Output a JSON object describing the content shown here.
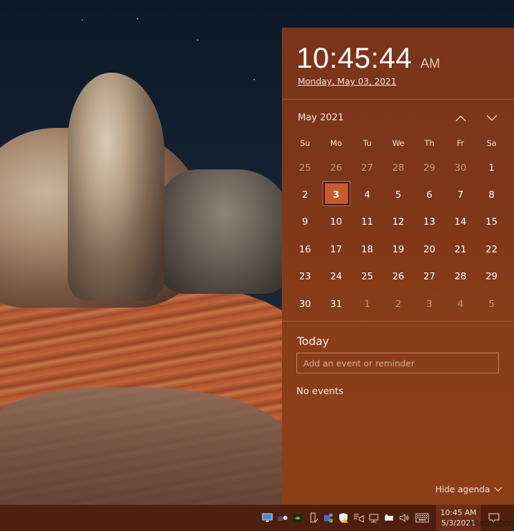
{
  "clock": {
    "time": "10:45:44",
    "ampm": "AM",
    "long_date": "Monday, May 03, 2021"
  },
  "calendar": {
    "month_label": "May 2021",
    "prev_icon": "chevron-up-icon",
    "next_icon": "chevron-down-icon",
    "weekdays": [
      "Su",
      "Mo",
      "Tu",
      "We",
      "Th",
      "Fr",
      "Sa"
    ],
    "selected_day": "3",
    "days": [
      {
        "label": "25",
        "current_month": false
      },
      {
        "label": "26",
        "current_month": false
      },
      {
        "label": "27",
        "current_month": false
      },
      {
        "label": "28",
        "current_month": false
      },
      {
        "label": "29",
        "current_month": false
      },
      {
        "label": "30",
        "current_month": false
      },
      {
        "label": "1",
        "current_month": true
      },
      {
        "label": "2",
        "current_month": true
      },
      {
        "label": "3",
        "current_month": true,
        "today": true
      },
      {
        "label": "4",
        "current_month": true
      },
      {
        "label": "5",
        "current_month": true
      },
      {
        "label": "6",
        "current_month": true
      },
      {
        "label": "7",
        "current_month": true
      },
      {
        "label": "8",
        "current_month": true
      },
      {
        "label": "9",
        "current_month": true
      },
      {
        "label": "10",
        "current_month": true
      },
      {
        "label": "11",
        "current_month": true
      },
      {
        "label": "12",
        "current_month": true
      },
      {
        "label": "13",
        "current_month": true
      },
      {
        "label": "14",
        "current_month": true
      },
      {
        "label": "15",
        "current_month": true
      },
      {
        "label": "16",
        "current_month": true
      },
      {
        "label": "17",
        "current_month": true
      },
      {
        "label": "18",
        "current_month": true
      },
      {
        "label": "19",
        "current_month": true
      },
      {
        "label": "20",
        "current_month": true
      },
      {
        "label": "21",
        "current_month": true
      },
      {
        "label": "22",
        "current_month": true
      },
      {
        "label": "23",
        "current_month": true
      },
      {
        "label": "24",
        "current_month": true
      },
      {
        "label": "25",
        "current_month": true
      },
      {
        "label": "26",
        "current_month": true
      },
      {
        "label": "27",
        "current_month": true
      },
      {
        "label": "28",
        "current_month": true
      },
      {
        "label": "29",
        "current_month": true
      },
      {
        "label": "30",
        "current_month": true
      },
      {
        "label": "31",
        "current_month": true
      },
      {
        "label": "1",
        "current_month": false
      },
      {
        "label": "2",
        "current_month": false
      },
      {
        "label": "3",
        "current_month": false
      },
      {
        "label": "4",
        "current_month": false
      },
      {
        "label": "5",
        "current_month": false
      }
    ]
  },
  "agenda": {
    "title": "Today",
    "input_placeholder": "Add an event or reminder",
    "input_value": "",
    "empty_text": "No events",
    "hide_label": "Hide agenda"
  },
  "taskbar": {
    "tray_icons": [
      "display-icon",
      "camera-device-icon",
      "nvidia-icon",
      "usb-drive-icon",
      "teams-icon",
      "security-shield-icon",
      "speech-icon",
      "network-icon",
      "battery-icon",
      "volume-icon",
      "touch-keyboard-icon"
    ],
    "time": "10:45 AM",
    "date": "5/3/2021",
    "notification_icon": "action-center-icon"
  },
  "watermark": "wsxdn.com",
  "colors": {
    "accent": "#7e3719",
    "selected_day": "#c95a2c",
    "taskbar": "#4e1f0e"
  }
}
